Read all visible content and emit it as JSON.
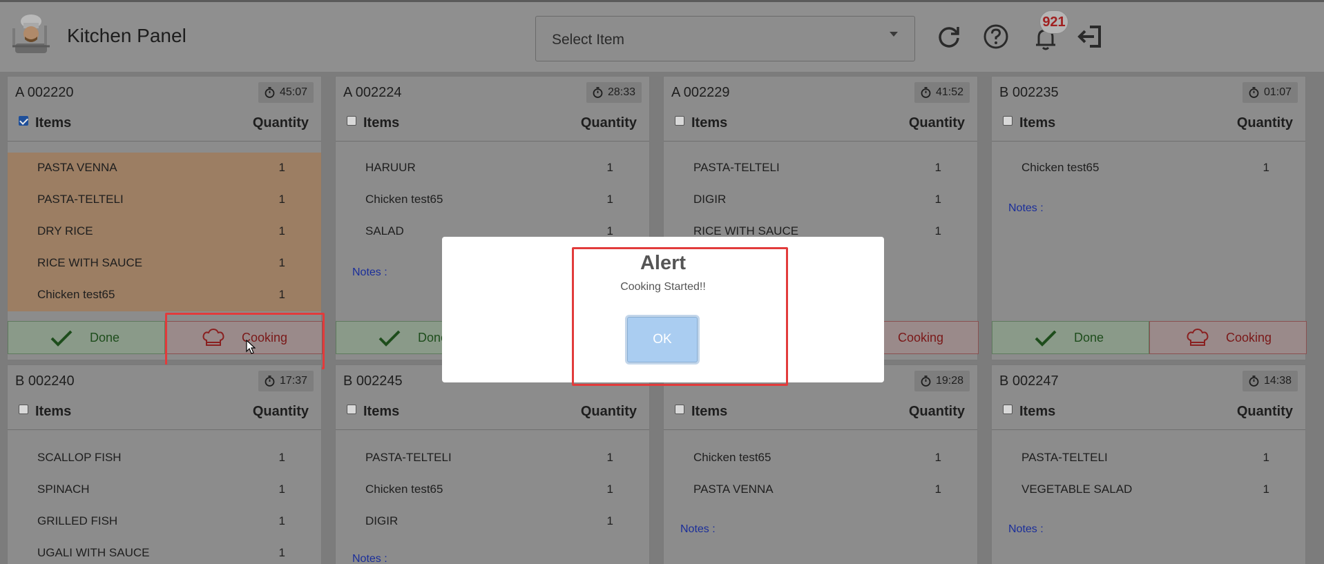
{
  "header": {
    "title": "Kitchen Panel",
    "select_placeholder": "Select Item",
    "notification_count": "921"
  },
  "labels": {
    "items": "Items",
    "quantity": "Quantity",
    "notes": "Notes :",
    "done": "Done",
    "cooking": "Cooking"
  },
  "orders": [
    {
      "id": "A 002220",
      "timer": "45:07",
      "checked": true,
      "status": "cooking",
      "items": [
        {
          "name": "PASTA VENNA",
          "qty": "1"
        },
        {
          "name": "PASTA-TELTELI",
          "qty": "1"
        },
        {
          "name": "DRY RICE",
          "qty": "1"
        },
        {
          "name": "RICE WITH SAUCE",
          "qty": "1"
        },
        {
          "name": "Chicken test65",
          "qty": "1"
        }
      ]
    },
    {
      "id": "A 002224",
      "timer": "28:33",
      "checked": false,
      "status": "pending",
      "items": [
        {
          "name": "HARUUR",
          "qty": "1"
        },
        {
          "name": "Chicken test65",
          "qty": "1"
        },
        {
          "name": "SALAD",
          "qty": "1"
        }
      ]
    },
    {
      "id": "A 002229",
      "timer": "41:52",
      "checked": false,
      "status": "pending",
      "items": [
        {
          "name": "PASTA-TELTELI",
          "qty": "1"
        },
        {
          "name": "DIGIR",
          "qty": "1"
        },
        {
          "name": "RICE WITH SAUCE",
          "qty": "1"
        }
      ]
    },
    {
      "id": "B 002235",
      "timer": "01:07",
      "checked": false,
      "status": "pending",
      "items": [
        {
          "name": "Chicken test65",
          "qty": "1"
        }
      ]
    },
    {
      "id": "B 002240",
      "timer": "17:37",
      "checked": false,
      "status": "pending",
      "items": [
        {
          "name": "SCALLOP FISH",
          "qty": "1"
        },
        {
          "name": "SPINACH",
          "qty": "1"
        },
        {
          "name": "GRILLED FISH",
          "qty": "1"
        },
        {
          "name": "UGALI WITH SAUCE",
          "qty": "1"
        }
      ]
    },
    {
      "id": "B 002245",
      "timer": "",
      "checked": false,
      "status": "pending",
      "items": [
        {
          "name": "PASTA-TELTELI",
          "qty": "1"
        },
        {
          "name": "Chicken test65",
          "qty": "1"
        },
        {
          "name": "DIGIR",
          "qty": "1"
        }
      ]
    },
    {
      "id": "",
      "timer": "19:28",
      "checked": false,
      "status": "pending",
      "items": [
        {
          "name": "Chicken test65",
          "qty": "1"
        },
        {
          "name": "PASTA VENNA",
          "qty": "1"
        }
      ]
    },
    {
      "id": "B 002247",
      "timer": "14:38",
      "checked": false,
      "status": "pending",
      "items": [
        {
          "name": "PASTA-TELTELI",
          "qty": "1"
        },
        {
          "name": "VEGETABLE SALAD",
          "qty": "1"
        }
      ]
    }
  ],
  "modal": {
    "title": "Alert",
    "message": "Cooking Started!!",
    "ok_label": "OK"
  },
  "colors": {
    "highlight": "#e23b3b",
    "cooking_row": "#9c7e63",
    "notes": "#1a2e9a",
    "ok_button": "#aacdf1"
  }
}
